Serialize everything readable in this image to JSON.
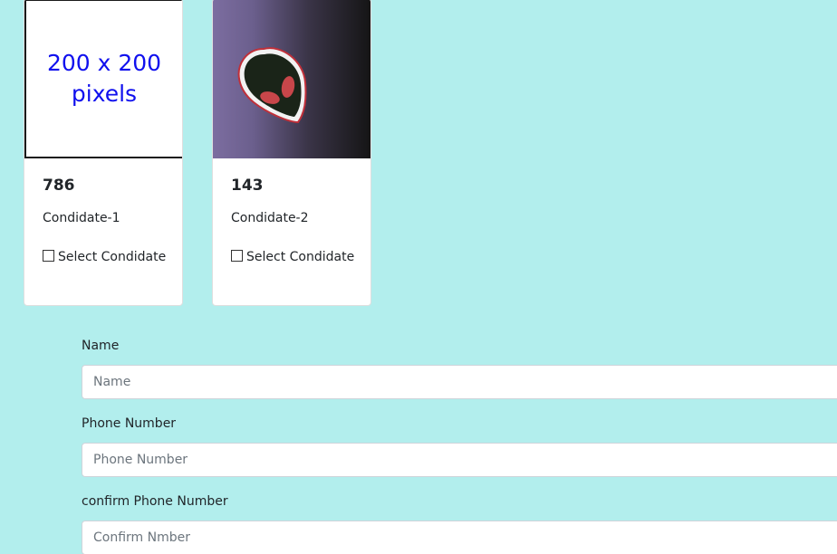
{
  "candidates": [
    {
      "image_text": "200 x 200 pixels",
      "votes": "786",
      "name": "Condidate-1",
      "select_label": "Select Condidate"
    },
    {
      "image_icon": "alien-head-icon",
      "votes": "143",
      "name": "Condidate-2",
      "select_label": "Select Condidate"
    }
  ],
  "form": {
    "name_label": "Name",
    "name_placeholder": "Name",
    "phone_label": "Phone Number",
    "phone_placeholder": "Phone Number",
    "confirm_label": "confirm Phone Number",
    "confirm_placeholder": "Confirm Nmber"
  },
  "colors": {
    "page_background": "#b2eeed",
    "placeholder_text": "#1010ee",
    "card_background": "#ffffff"
  }
}
